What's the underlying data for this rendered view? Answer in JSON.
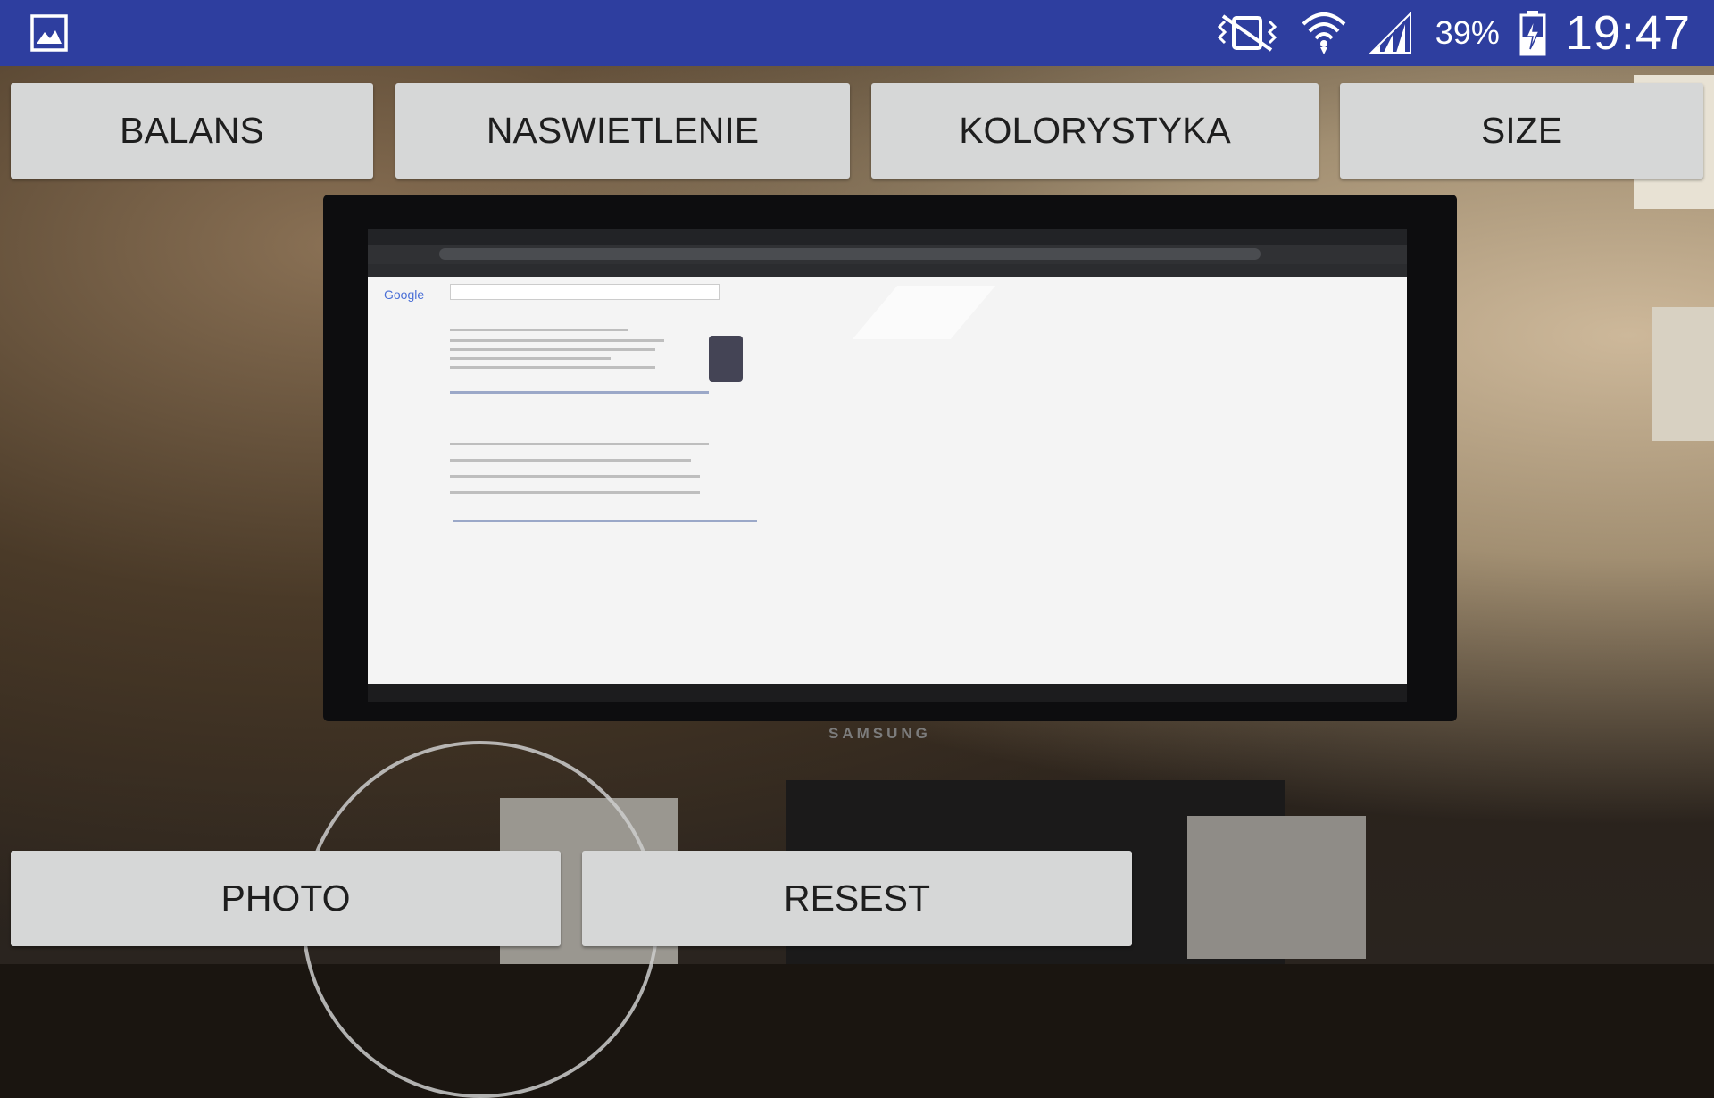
{
  "status_bar": {
    "gallery_icon": "image-icon",
    "mute_icon": "vibrate-off-icon",
    "wifi_icon": "wifi-icon",
    "signal_icon": "cellular-signal-icon",
    "battery_percent": "39%",
    "battery_icon": "battery-charging-icon",
    "time": "19:47",
    "background": "#2e3e9f"
  },
  "toolbar_top": {
    "balans_label": "BALANS",
    "naswietlenie_label": "NASWIETLENIE",
    "kolorystyka_label": "KOLORYSTYKA",
    "size_label": "SIZE"
  },
  "toolbar_bottom": {
    "photo_label": "PHOTO",
    "resest_label": "RESEST"
  },
  "preview": {
    "monitor_brand": "SAMSUNG",
    "browser_logo": "Google"
  },
  "colors": {
    "button_bg": "#d6d7d7",
    "button_text": "#1e1e1e"
  }
}
